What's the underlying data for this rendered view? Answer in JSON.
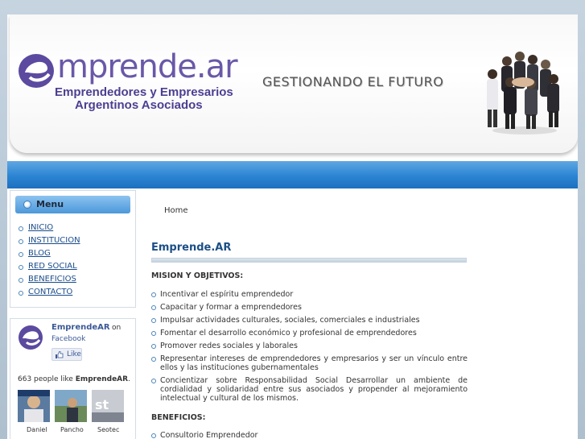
{
  "header": {
    "logo_word": "mprende.ar",
    "logo_line1": "Emprendedores  y Empresarios",
    "logo_line2": "Argentinos Asociados",
    "slogan": "GESTIONANDO EL FUTURO"
  },
  "sidebar": {
    "menu_title": "Menu",
    "menu_items": [
      {
        "label": "INICIO"
      },
      {
        "label": "INSTITUCION"
      },
      {
        "label": "BLOG"
      },
      {
        "label": "RED SOCIAL"
      },
      {
        "label": "BENEFICIOS"
      },
      {
        "label": "CONTACTO"
      }
    ]
  },
  "facebook": {
    "page_name": "EmprendeAR",
    "on": "on",
    "facebook": "Facebook",
    "like_label": "Like",
    "count_text": "663 people like",
    "count_name": "EmprendeAR",
    "count_end": ".",
    "faces": [
      {
        "name": "Daniel"
      },
      {
        "name": "Pancho"
      },
      {
        "name": "Seotec"
      }
    ]
  },
  "main": {
    "breadcrumb": "Home",
    "title": "Emprende.AR",
    "mission_heading": "MISION Y OBJETIVOS:",
    "mission_items": [
      "Incentivar el espíritu emprendedor",
      "Capacitar y formar a emprendedores",
      "Impulsar actividades culturales, sociales, comerciales e industriales",
      "Fomentar el desarrollo económico y profesional de emprendedores",
      "Promover redes sociales y laborales",
      "Representar intereses de emprendedores y empresarios y ser un vínculo entre ellos y las instituciones gubernamentales",
      "Concientizar sobre Responsabilidad Social Desarrollar un ambiente de cordialidad y solidaridad entre sus asociados y propender al mejoramiento intelectual y cultural de los mismos."
    ],
    "benefits_heading": "BENEFICIOS:",
    "benefits_items": [
      "Consultorio Emprendedor"
    ]
  },
  "colors": {
    "brand_purple": "#6a58a8",
    "nav_blue": "#2b84d3",
    "link_blue": "#1a4c8a"
  }
}
